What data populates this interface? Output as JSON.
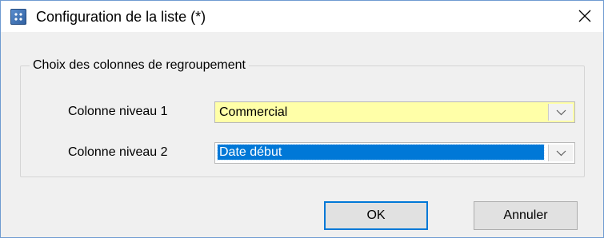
{
  "window": {
    "title": "Configuration de la liste (*)",
    "icon": "app-grid-icon",
    "close_icon": "close-icon"
  },
  "group": {
    "legend": "Choix des colonnes de regroupement",
    "rows": [
      {
        "label": "Colonne niveau 1",
        "value": "Commercial",
        "background": "#ffffa8"
      },
      {
        "label": "Colonne niveau 2",
        "value": "Date début",
        "selected": true
      }
    ]
  },
  "buttons": {
    "ok": "OK",
    "cancel": "Annuler"
  },
  "colors": {
    "accent": "#0078d7",
    "dialog_bg": "#f0f0f0",
    "highlight_field": "#ffffa8"
  }
}
